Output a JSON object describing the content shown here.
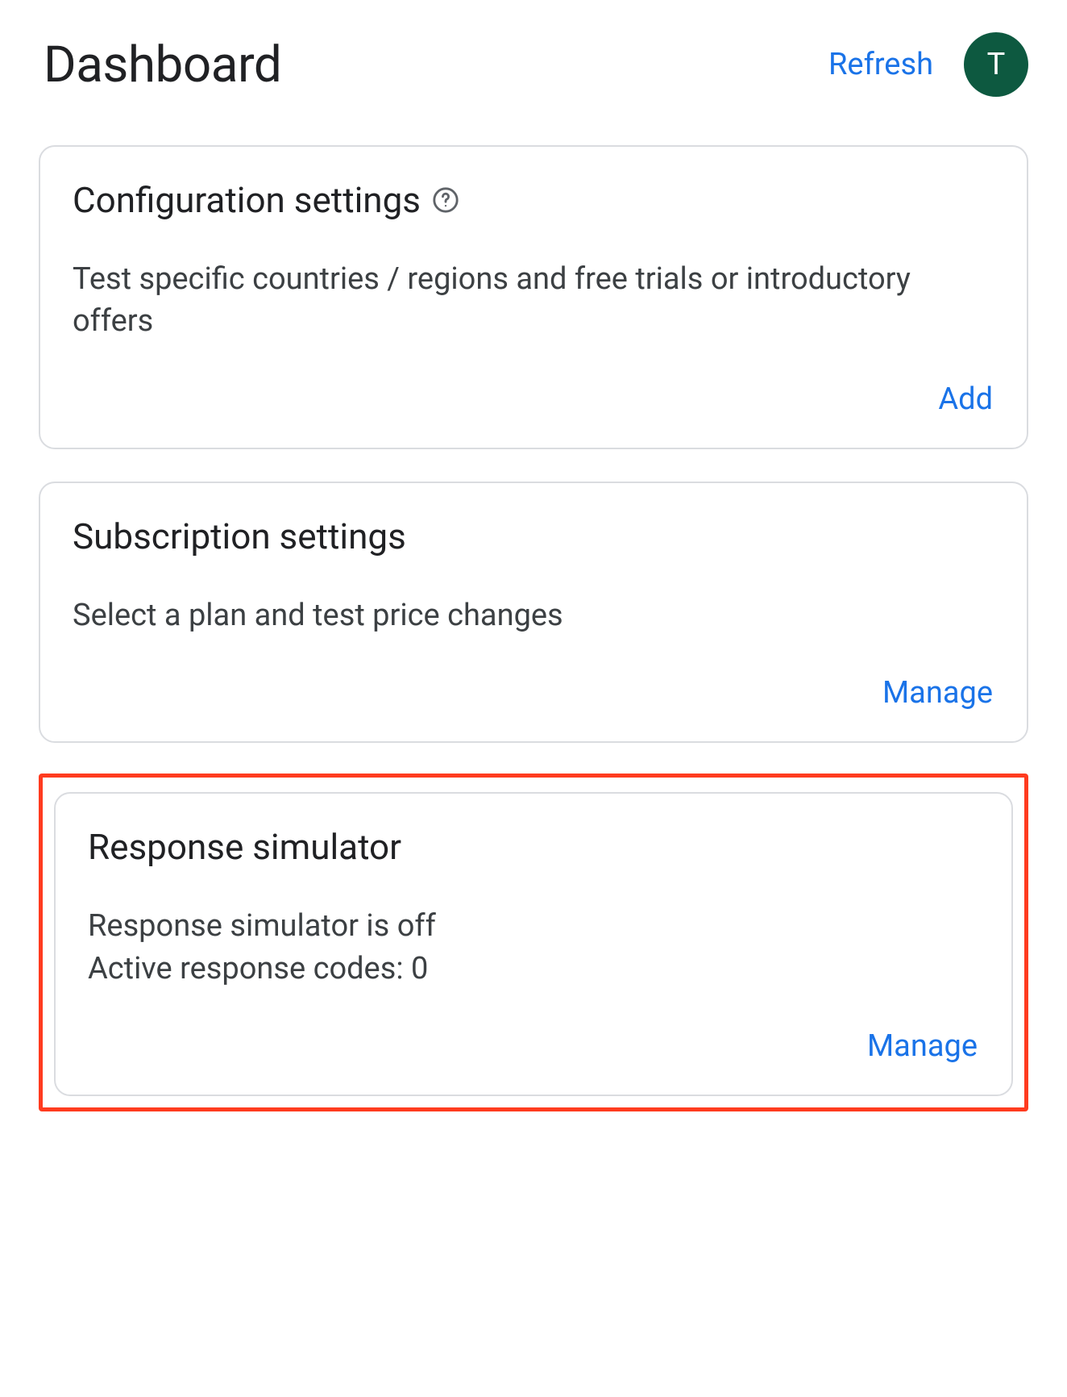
{
  "header": {
    "title": "Dashboard",
    "refresh_label": "Refresh",
    "avatar_letter": "T",
    "avatar_bg": "#0d5940"
  },
  "cards": {
    "configuration": {
      "title": "Configuration settings",
      "description": "Test specific countries / regions and free trials or introductory offers",
      "action_label": "Add"
    },
    "subscription": {
      "title": "Subscription settings",
      "description": "Select a plan and test price changes",
      "action_label": "Manage"
    },
    "response_simulator": {
      "title": "Response simulator",
      "status_line": "Response simulator is off",
      "codes_line": "Active response codes: 0",
      "action_label": "Manage"
    }
  }
}
